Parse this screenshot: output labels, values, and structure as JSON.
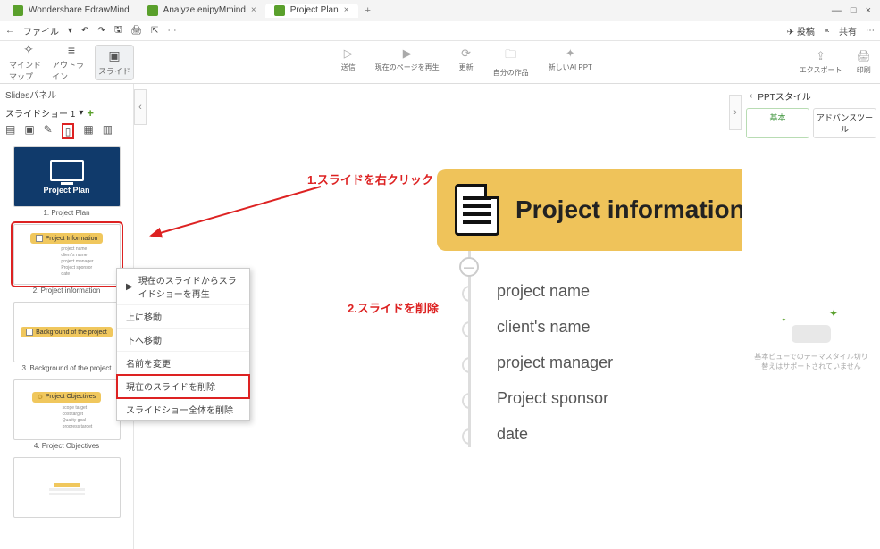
{
  "tabs": {
    "t0": "Wondershare EdrawMind",
    "t1": "Analyze.enipyMmind",
    "t2": "Project Plan"
  },
  "menubar": {
    "file": "ファイル",
    "right": {
      "post": "投稿",
      "share": "共有"
    }
  },
  "toolbar_left": {
    "mindmap": "マインドマップ",
    "outline": "アウトライン",
    "slide": "スライド"
  },
  "toolbar_mid": {
    "b1": "送信",
    "b2": "現在のページを再生",
    "b3": "更新",
    "b4": "自分の作品",
    "b5": "新しいAI PPT"
  },
  "toolbar_right": {
    "export": "エクスポート",
    "print": "印刷"
  },
  "left_panel": {
    "title": "Slidesパネル",
    "slideshow_label": "スライドショー 1"
  },
  "thumbs": {
    "t1": {
      "title": "Project Plan",
      "caption": "1. Project Plan"
    },
    "t2": {
      "card": "Project Information",
      "caption": "2. Project information",
      "lines": [
        "project name",
        "client's name",
        "project manager",
        "Project sponsor",
        "date"
      ]
    },
    "t3": {
      "card": "Background of the project",
      "caption": "3. Background of the project"
    },
    "t4": {
      "card": "Project Objectives",
      "caption": "4. Project Objectives",
      "lines": [
        "scope target",
        "cost target",
        "Quality goal",
        "progress target"
      ]
    }
  },
  "context_menu": {
    "i1": "現在のスライドからスライドショーを再生",
    "i2": "上に移動",
    "i3": "下へ移動",
    "i4": "名前を変更",
    "i5": "現在のスライドを削除",
    "i6": "スライドショー全体を削除"
  },
  "annotations": {
    "a1": "1.スライドを右クリック",
    "a2": "2.スライドを削除"
  },
  "canvas": {
    "title": "Project information",
    "nodes": [
      "project name",
      "client's name",
      "project manager",
      "Project sponsor",
      "date"
    ]
  },
  "right_panel": {
    "title": "PPTスタイル",
    "tab1": "基本",
    "tab2": "アドバンスツール",
    "msg": "基本ビューでのテーマスタイル切り替えはサポートされていません"
  }
}
